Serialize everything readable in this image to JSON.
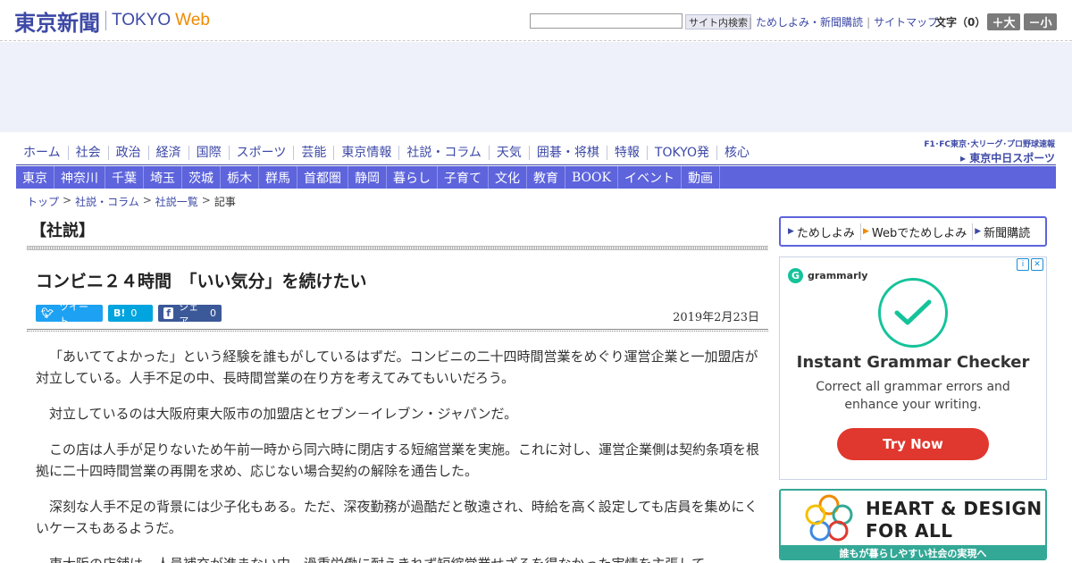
{
  "header": {
    "logo_jp": "東京新聞",
    "logo_tokyo": "TOKYO",
    "logo_web": "Web",
    "search_button": "サイト内検索",
    "top_links": [
      "ためしよみ・新聞購読",
      "サイトマップ"
    ],
    "moji_label": "文字（0）",
    "font_bigger": "＋大",
    "font_smaller": "－小",
    "colors": {
      "brand": "#3d49a6",
      "web_orange": "#f08a00"
    }
  },
  "nav_main": {
    "items": [
      "ホーム",
      "社会",
      "政治",
      "経済",
      "国際",
      "スポーツ",
      "芸能",
      "東京情報",
      "社説・コラム",
      "天気",
      "囲碁・将棋",
      "特報",
      "TOKYO発",
      "核心"
    ],
    "chunichi_line1": "F1･FC東京･大リーグ･プロ野球速報",
    "chunichi_line2": "▸ 東京中日スポーツ"
  },
  "nav_sub": {
    "items": [
      "東京",
      "神奈川",
      "千葉",
      "埼玉",
      "茨城",
      "栃木",
      "群馬",
      "首都圏",
      "静岡",
      "暮らし",
      "子育て",
      "文化",
      "教育",
      "BOOK",
      "イベント",
      "動画"
    ],
    "color": "#5d64dc"
  },
  "breadcrumb": {
    "items": [
      "トップ",
      "社説・コラム",
      "社説一覧"
    ],
    "current": "記事"
  },
  "article": {
    "section": "【社説】",
    "title": "コンビニ２４時間　「いい気分」を続けたい",
    "share_tweet": "ツイート",
    "share_hatena_count": "0",
    "share_fb": "シェア",
    "share_fb_count": "0",
    "date": "2019年2月23日",
    "paragraphs": [
      "「あいててよかった」という経験を誰もがしているはずだ。コンビニの二十四時間営業をめぐり運営企業と一加盟店が対立している。人手不足の中、長時間営業の在り方を考えてみてもいいだろう。",
      "対立しているのは大阪府東大阪市の加盟店とセブン－イレブン・ジャパンだ。",
      "この店は人手が足りないため午前一時から同六時に閉店する短縮営業を実施。これに対し、運営企業側は契約条項を根拠に二十四時間営業の再開を求め、応じない場合契約の解除を通告した。",
      "深刻な人手不足の背景には少子化もある。ただ、深夜勤務が過酷だと敬遠され、時給を高く設定しても店員を集めにくいケースもあるようだ。",
      "東大阪の店舗は、人員補充が進まない中、過重労働に耐えきれず短縮営業せざるを得なかった実情を主張して"
    ]
  },
  "rail": {
    "subscribe": [
      "ためしよみ",
      "Webでためしよみ",
      "新聞購読"
    ],
    "ad1": {
      "brand": "grammarly",
      "headline": "Instant Grammar Checker",
      "sub": "Correct all grammar errors and enhance your writing.",
      "cta": "Try Now",
      "accent": "#15c39a",
      "cta_color": "#e0382e"
    },
    "ad2": {
      "line1": "HEART & DESIGN",
      "line2": "FOR ALL",
      "band": "誰もが暮らしやすい社会の実現へ",
      "color": "#34a896"
    }
  }
}
